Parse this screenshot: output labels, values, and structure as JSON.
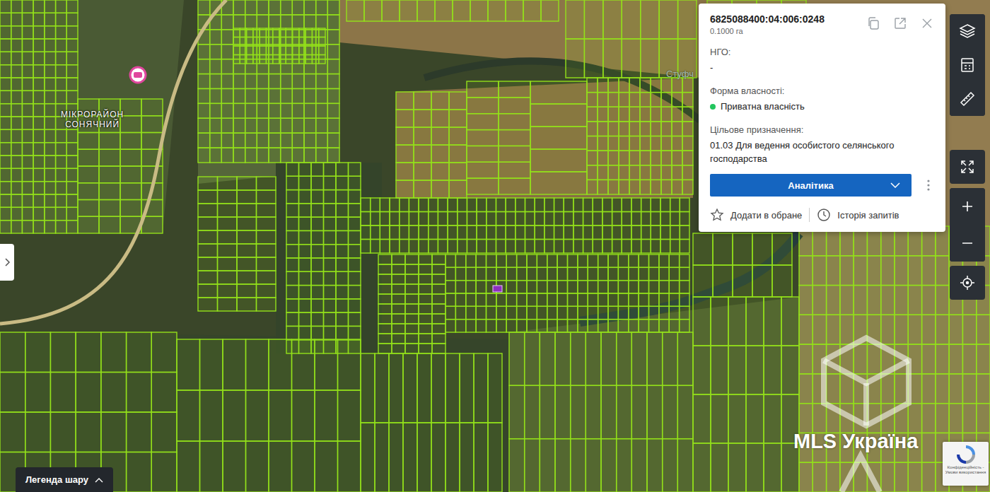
{
  "map": {
    "district_label": [
      "МІКРОРАЙОН",
      "СОНЯЧНИЙ"
    ],
    "village_label": "Стуфч"
  },
  "parcel_card": {
    "cadastral_number": "6825088400:04:006:0248",
    "area": "0.1000 га",
    "fields": [
      {
        "label": "НГО:",
        "value": "-"
      },
      {
        "label": "Форма власності:",
        "value": "Приватна власність",
        "color": "#22c55e"
      },
      {
        "label": "Цільове призначення:",
        "value": "01.03 Для ведення особистого селянського господарства"
      }
    ],
    "analytics_button": "Аналітика",
    "actions": [
      "Додати в обране",
      "Історія запитів"
    ]
  },
  "legend_button": "Легенда шару",
  "watermark": "MLS Україна",
  "recaptcha": "Конфіденційність - Умови використання"
}
